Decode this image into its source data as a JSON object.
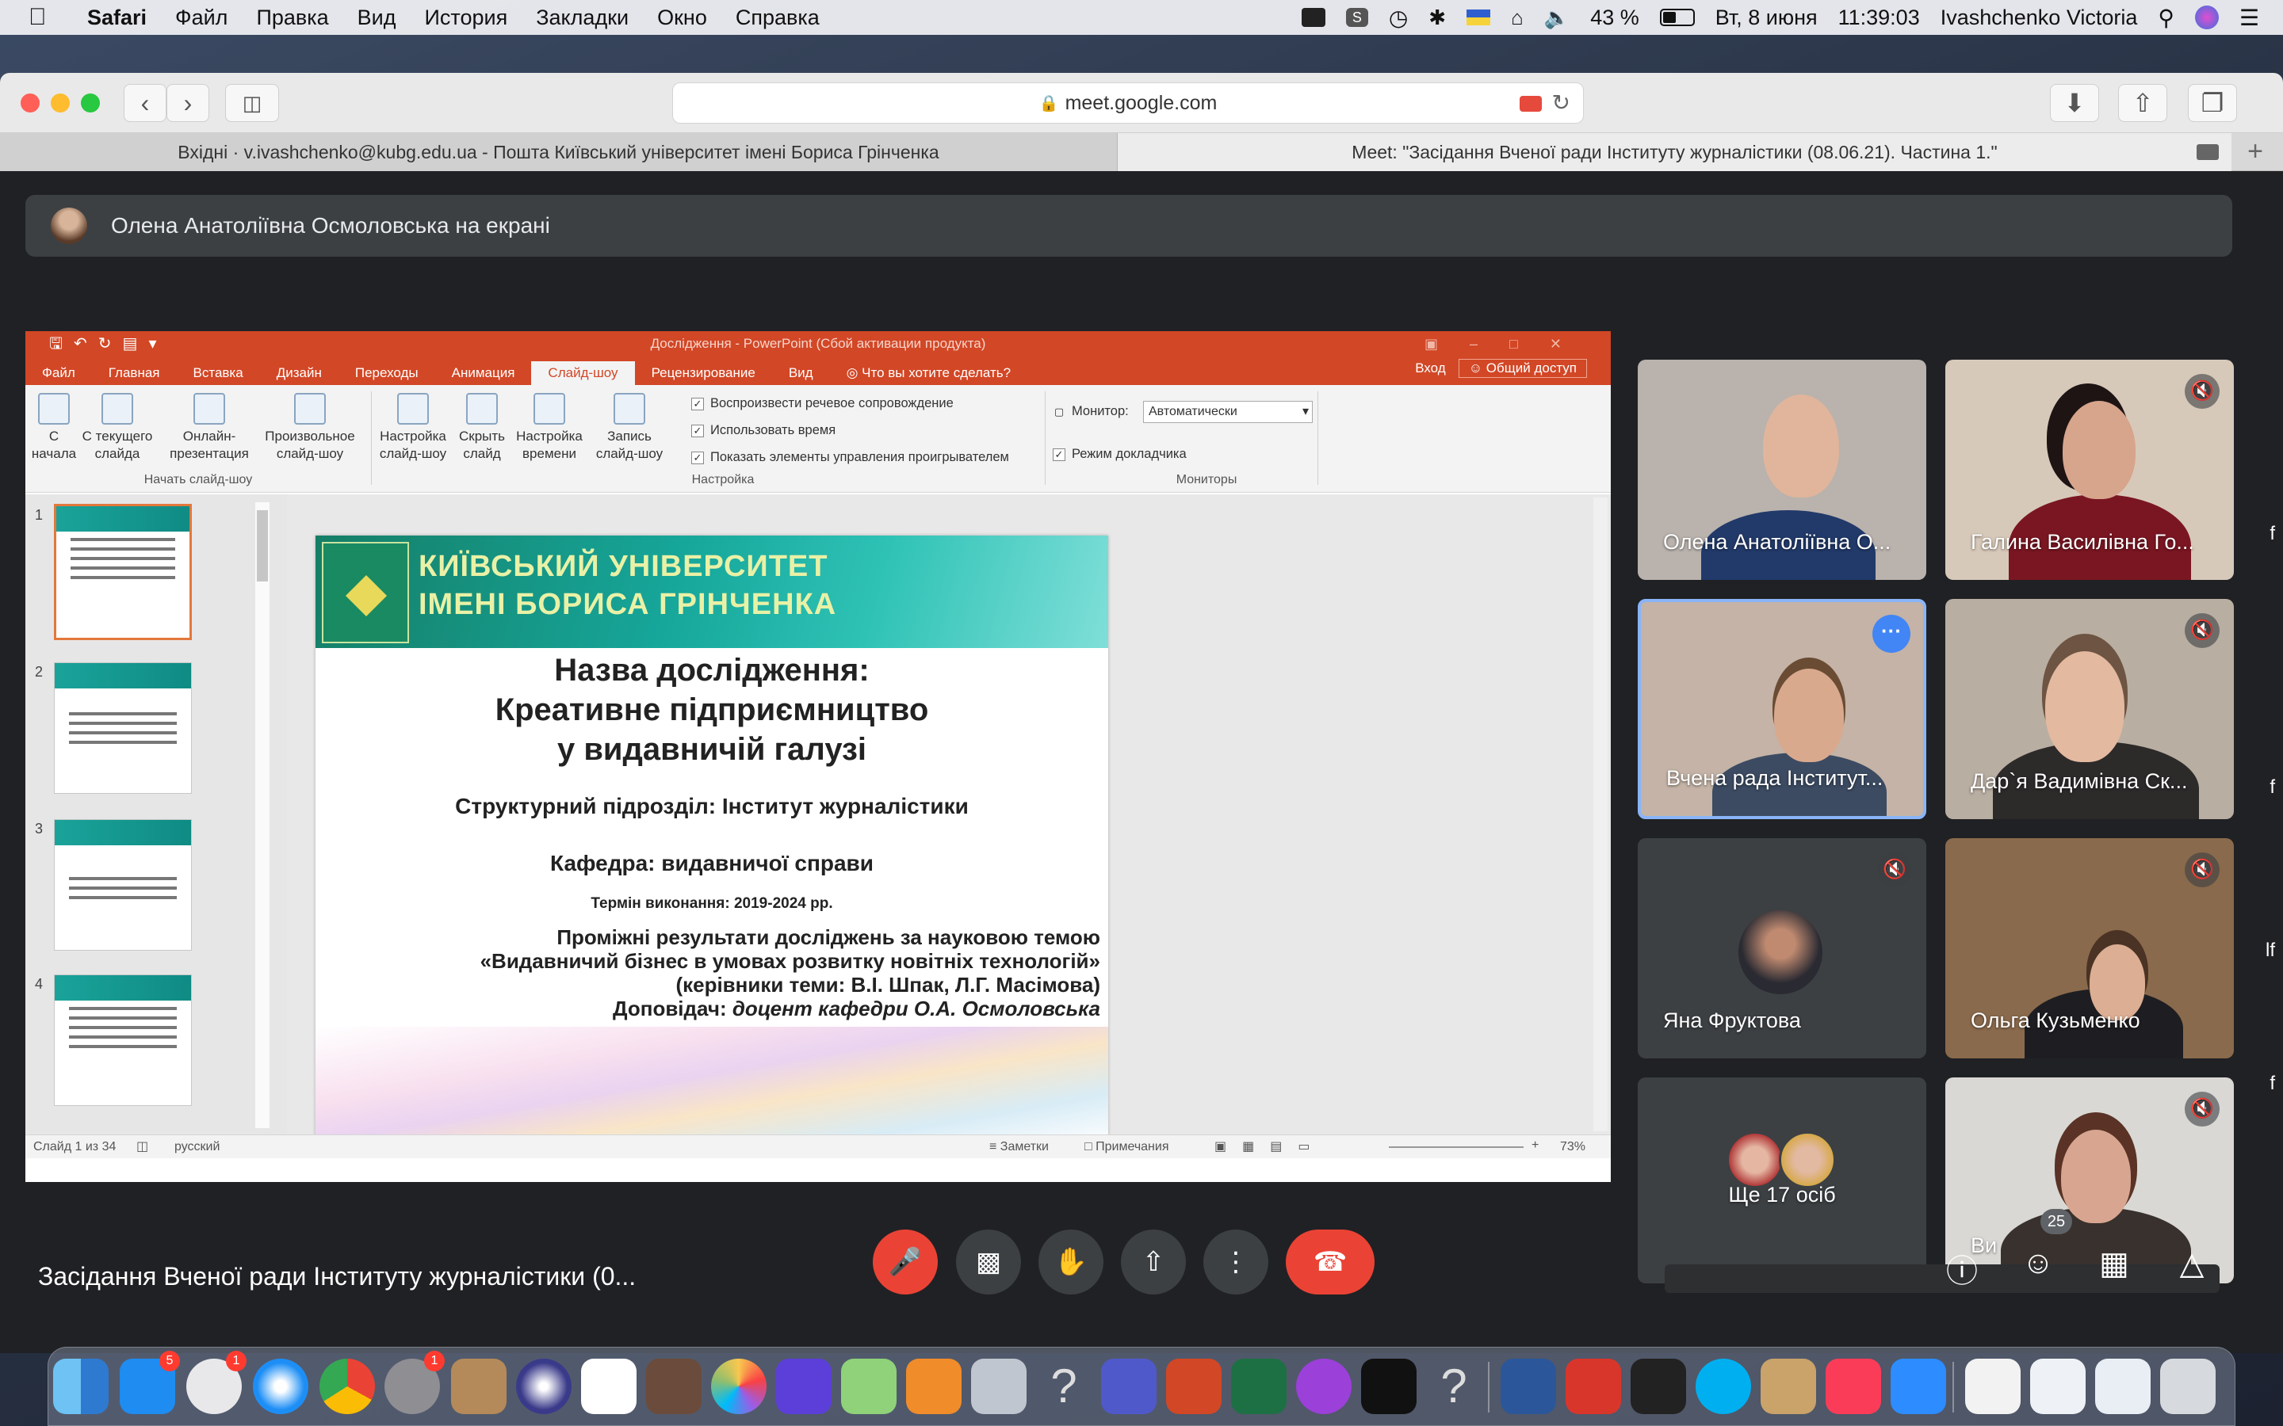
{
  "menubar": {
    "app": "Safari",
    "items": [
      "Файл",
      "Правка",
      "Вид",
      "История",
      "Закладки",
      "Окно",
      "Справка"
    ],
    "battery": "43 %",
    "date": "Вт, 8 июня",
    "time": "11:39:03",
    "user": "Ivashchenko Victoria"
  },
  "browser": {
    "url": "meet.google.com",
    "tabs": [
      {
        "title": "Вхідні · v.ivashchenko@kubg.edu.ua - Пошта Київський університет імені Бориса Грінченка"
      },
      {
        "title": "Meet: \"Засідання Вченої ради Інституту журналістики (08.06.21). Частина 1.\""
      }
    ]
  },
  "meet": {
    "presenter_banner": "Олена Анатоліївна Осмоловська на екрані",
    "meeting_title": "Засідання Вченої ради Інституту журналістики (0...",
    "participant_count": "25",
    "tiles": [
      {
        "name": "Олена Анатоліївна О..."
      },
      {
        "name": "Галина Василівна Го..."
      },
      {
        "name": "Вчена рада Інститут..."
      },
      {
        "name": "Дар`я Вадимівна Ск..."
      },
      {
        "name": "Яна Фруктова"
      },
      {
        "name": "Ольга Кузьменко"
      },
      {
        "name": "Ще 17 осіб"
      },
      {
        "name": "Ви"
      }
    ],
    "edge_chars": [
      "f",
      "f",
      "lf",
      "f"
    ]
  },
  "powerpoint": {
    "title": "Дослідження - PowerPoint (Сбой активации продукта)",
    "tabs": [
      "Файл",
      "Главная",
      "Вставка",
      "Дизайн",
      "Переходы",
      "Анимация",
      "Слайд-шоу",
      "Рецензирование",
      "Вид",
      "Что вы хотите сделать?"
    ],
    "active_tab": "Слайд-шоу",
    "signin": "Вход",
    "share": "Общий доступ",
    "ribbon": {
      "btn_from_start": "С начала",
      "btn_from_current": "С текущего слайда",
      "btn_online": "Онлайн-презентация",
      "btn_custom": "Произвольное слайд-шоу",
      "group_start": "Начать слайд-шоу",
      "btn_setup": "Настройка слайд-шоу",
      "btn_hide": "Скрыть слайд",
      "btn_rehearse": "Настройка времени",
      "btn_record": "Запись слайд-шоу",
      "chk_narration": "Воспроизвести речевое сопровождение",
      "chk_timings": "Использовать время",
      "chk_controls": "Показать элементы управления проигрывателем",
      "group_setup": "Настройка",
      "monitor_label": "Монитор:",
      "monitor_value": "Автоматически",
      "chk_presenter": "Режим докладчика",
      "group_monitors": "Мониторы"
    },
    "thumb_numbers": [
      "1",
      "2",
      "3",
      "4"
    ],
    "status": {
      "slide": "Слайд 1 из 34",
      "lang": "русский",
      "notes": "Заметки",
      "comments": "Примечания",
      "zoom": "73%"
    },
    "slide": {
      "uni_line1": "КИЇВСЬКИЙ УНІВЕРСИТЕТ",
      "uni_line2": "ІМЕНІ БОРИСА ГРІНЧЕНКА",
      "title1": "Назва дослідження:",
      "title2": "Креативне підприємництво",
      "title3": "у видавничій галузі",
      "unit": "Структурний підрозділ: Інститут журналістики",
      "dept": "Кафедра: видавничої справи",
      "term": "Термін виконання: 2019-2024 рр.",
      "results": "Проміжні результати досліджень за науковою темою",
      "topic": "«Видавничий бізнес в умовах розвитку новітніх технологій»",
      "heads": "(керівники теми: В.І. Шпак, Л.Г. Масімова)",
      "speaker_label": "Доповідач:",
      "speaker": "доцент кафедри О.А. Осмоловська"
    }
  },
  "colors": {
    "meet_bg": "#202124",
    "tile_bg": "#3c4043",
    "red": "#ea4335",
    "ppt_orange": "#d24726",
    "active_border": "#8ab4f8"
  }
}
